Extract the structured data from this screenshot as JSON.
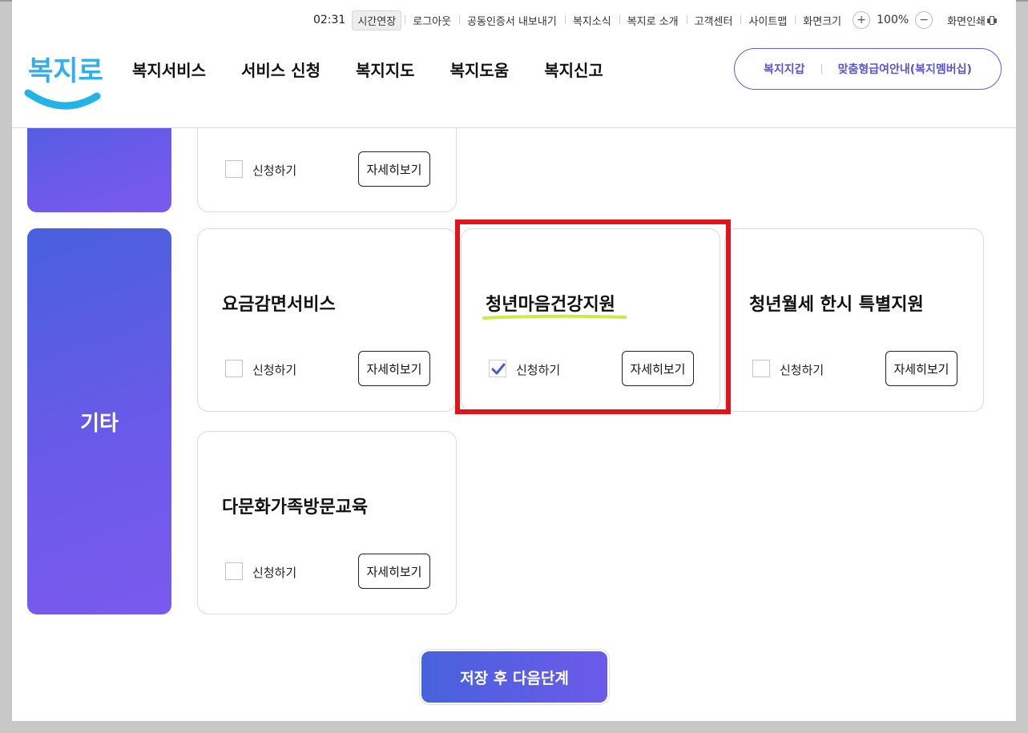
{
  "utility": {
    "time": "02:31",
    "extend": "시간연장",
    "links": [
      "로그아웃",
      "공동인증서 내보내기",
      "복지소식",
      "복지로 소개",
      "고객센터",
      "사이트맵",
      "화면크기"
    ],
    "zoom_in": "+",
    "zoom_value": "100%",
    "zoom_out": "−",
    "print": "화면인쇄"
  },
  "logo": {
    "text": "복지로"
  },
  "gnb": [
    "복지서비스",
    "서비스 신청",
    "복지지도",
    "복지도움",
    "복지신고"
  ],
  "pill": {
    "left": "복지지갑",
    "right": "맞춤형급여안내(복지멤버십)"
  },
  "category": {
    "label": "기타"
  },
  "cards": [
    {
      "title": "",
      "checkbox_label": "신청하기",
      "checked": false,
      "detail_label": "자세히보기"
    },
    {
      "title": "요금감면서비스",
      "checkbox_label": "신청하기",
      "checked": false,
      "detail_label": "자세히보기"
    },
    {
      "title": "청년마음건강지원",
      "checkbox_label": "신청하기",
      "checked": true,
      "detail_label": "자세히보기"
    },
    {
      "title": "청년월세 한시 특별지원",
      "checkbox_label": "신청하기",
      "checked": false,
      "detail_label": "자세히보기"
    },
    {
      "title": "다문화가족방문교육",
      "checkbox_label": "신청하기",
      "checked": false,
      "detail_label": "자세히보기"
    }
  ],
  "next_button": "저장 후 다음단계",
  "colors": {
    "accent": "#5a54d6",
    "category_gradient_start": "#4860dd",
    "category_gradient_end": "#7a5aee",
    "highlight_box": "#e0141b",
    "underline": "#c8ec4a",
    "checkmark": "#4a5ad8"
  }
}
